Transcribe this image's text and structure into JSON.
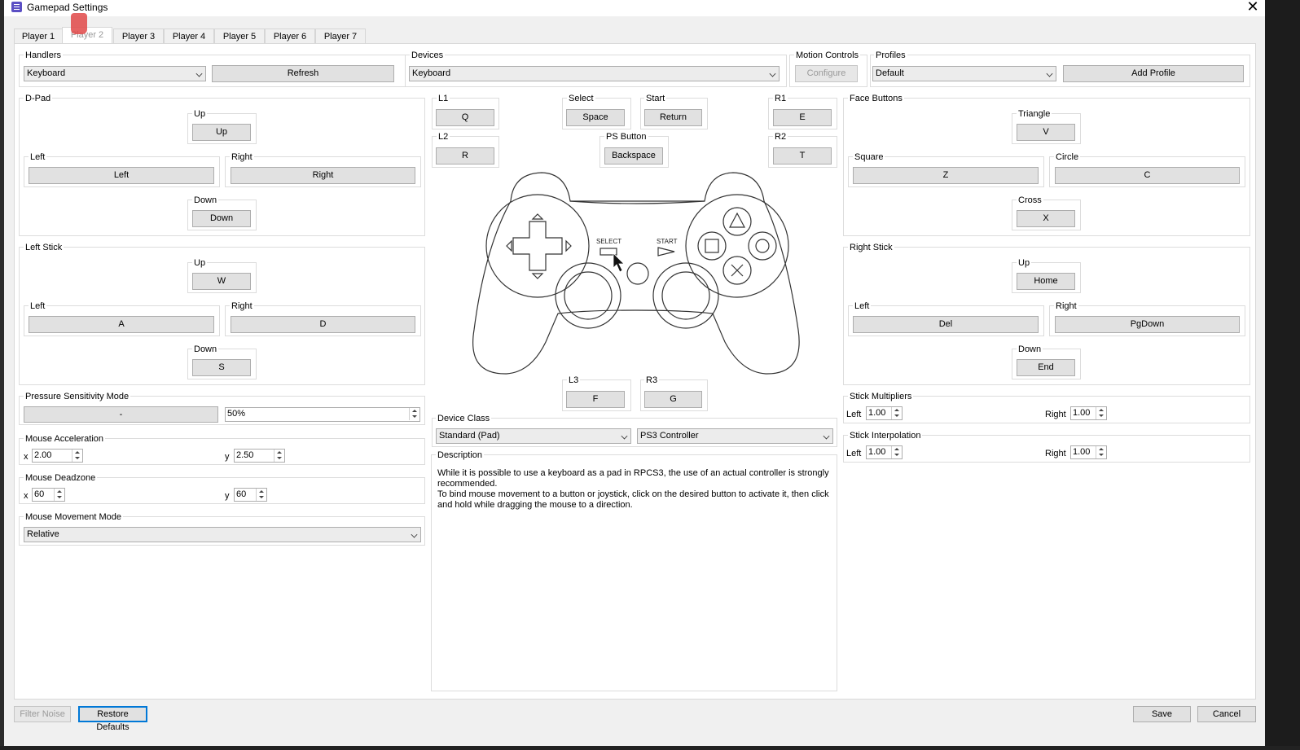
{
  "window": {
    "title": "Gamepad Settings"
  },
  "tabs": [
    "Player 1",
    "Player 2",
    "Player 3",
    "Player 4",
    "Player 5",
    "Player 6",
    "Player 7"
  ],
  "handlers": {
    "label": "Handlers",
    "value": "Keyboard",
    "refresh": "Refresh"
  },
  "devices": {
    "label": "Devices",
    "value": "Keyboard"
  },
  "motion": {
    "label": "Motion Controls",
    "button": "Configure"
  },
  "profiles": {
    "label": "Profiles",
    "value": "Default",
    "add": "Add Profile"
  },
  "dpad": {
    "label": "D-Pad",
    "up_label": "Up",
    "up": "Up",
    "left_label": "Left",
    "left": "Left",
    "right_label": "Right",
    "right": "Right",
    "down_label": "Down",
    "down": "Down"
  },
  "left_stick": {
    "label": "Left Stick",
    "up_label": "Up",
    "up": "W",
    "left_label": "Left",
    "left": "A",
    "right_label": "Right",
    "right": "D",
    "down_label": "Down",
    "down": "S"
  },
  "pressure": {
    "label": "Pressure Sensitivity Mode",
    "button": "-",
    "value": "50%"
  },
  "mouse_accel": {
    "label": "Mouse Acceleration",
    "x_label": "x",
    "x": "2.00",
    "y_label": "y",
    "y": "2.50"
  },
  "mouse_deadzone": {
    "label": "Mouse Deadzone",
    "x_label": "x",
    "x": "60",
    "y_label": "y",
    "y": "60"
  },
  "mouse_move": {
    "label": "Mouse Movement Mode",
    "value": "Relative"
  },
  "shoulder": {
    "l1_label": "L1",
    "l1": "Q",
    "l2_label": "L2",
    "l2": "R",
    "r1_label": "R1",
    "r1": "E",
    "r2_label": "R2",
    "r2": "T"
  },
  "center": {
    "select_label": "Select",
    "select": "Space",
    "start_label": "Start",
    "start": "Return",
    "ps_label": "PS Button",
    "ps": "Backspace",
    "l3_label": "L3",
    "l3": "F",
    "r3_label": "R3",
    "r3": "G"
  },
  "pad_image": {
    "select_text": "SELECT",
    "start_text": "START"
  },
  "device_class": {
    "label": "Device Class",
    "class": "Standard (Pad)",
    "type": "PS3 Controller"
  },
  "description": {
    "label": "Description",
    "line1": "While it is possible to use a keyboard as a pad in RPCS3, the use of an actual controller is strongly",
    "line2": "recommended.",
    "line3": "To bind mouse movement to a button or joystick, click on the desired button to activate it, then click",
    "line4": "and hold while dragging the mouse to a direction."
  },
  "face": {
    "label": "Face Buttons",
    "triangle_label": "Triangle",
    "triangle": "V",
    "square_label": "Square",
    "square": "Z",
    "circle_label": "Circle",
    "circle": "C",
    "cross_label": "Cross",
    "cross": "X"
  },
  "right_stick": {
    "label": "Right Stick",
    "up_label": "Up",
    "up": "Home",
    "left_label": "Left",
    "left": "Del",
    "right_label": "Right",
    "right": "PgDown",
    "down_label": "Down",
    "down": "End"
  },
  "stick_mult": {
    "label": "Stick Multipliers",
    "left_label": "Left",
    "left": "1.00",
    "right_label": "Right",
    "right": "1.00"
  },
  "stick_interp": {
    "label": "Stick Interpolation",
    "left_label": "Left",
    "left": "1.00",
    "right_label": "Right",
    "right": "1.00"
  },
  "footer": {
    "filter_noise": "Filter Noise",
    "restore": "Restore Defaults",
    "save": "Save",
    "cancel": "Cancel"
  },
  "colors": {
    "window_bg": "#f0f0f0",
    "button_bg": "#e1e1e1",
    "accent": "#0078d7",
    "title_icon": "#5b4fc4"
  }
}
